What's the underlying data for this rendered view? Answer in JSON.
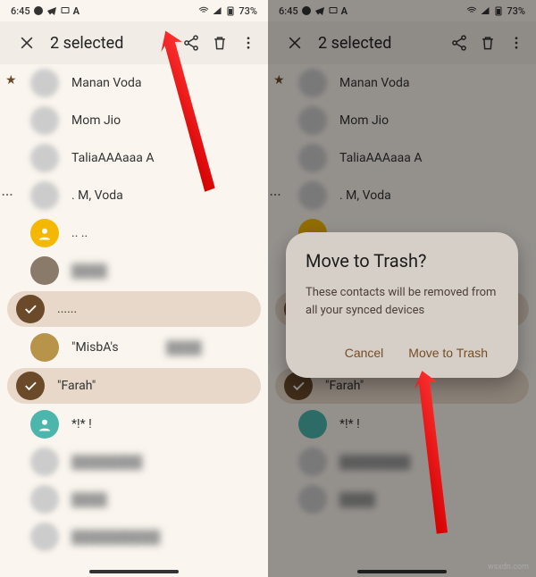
{
  "status": {
    "time": "6:45",
    "battery": "73%"
  },
  "header": {
    "title": "2 selected"
  },
  "contacts": [
    {
      "name": "Manan Voda",
      "star": true
    },
    {
      "name": "Mom Jio"
    },
    {
      "name": "TaliaAAAaaa A"
    },
    {
      "name": ". M, Voda",
      "dots": true
    },
    {
      "name": ".. .."
    },
    {
      "name": "......"
    },
    {
      "name": "\"MisbA's"
    },
    {
      "name": "\"Farah\""
    },
    {
      "name": "*!* !"
    }
  ],
  "dialog": {
    "title": "Move to Trash?",
    "body": "These contacts will be removed from all your synced devices",
    "cancel": "Cancel",
    "confirm": "Move to Trash"
  },
  "watermark": "wsxdn.com"
}
